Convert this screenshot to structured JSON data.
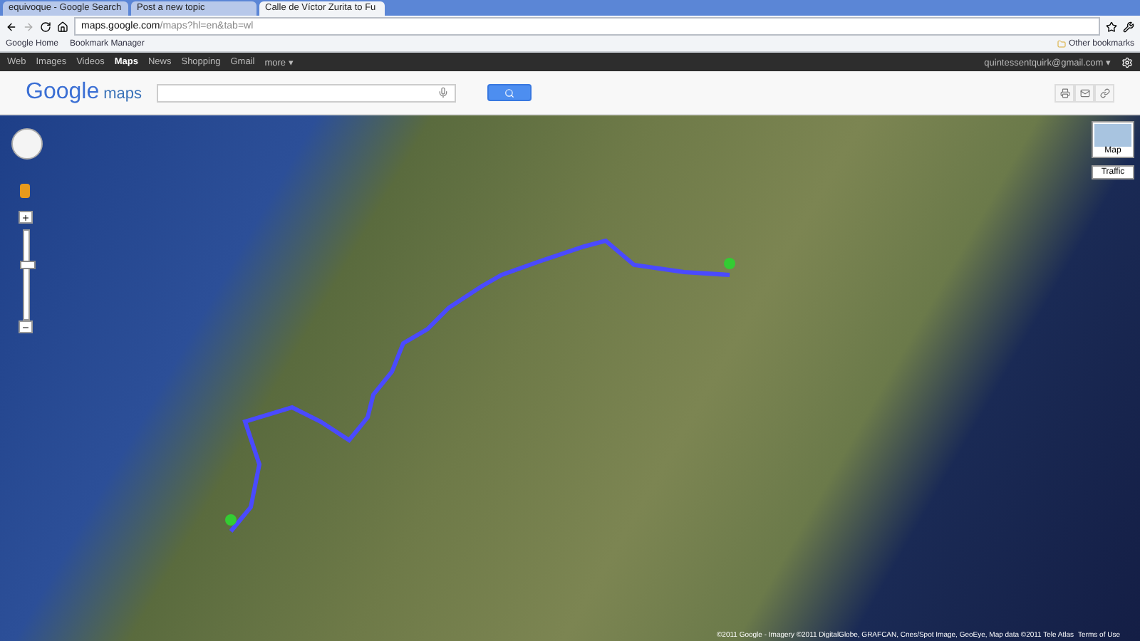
{
  "browser": {
    "tabs": [
      {
        "label": "equivoque - Google Search",
        "selected": false
      },
      {
        "label": "Post a new topic",
        "selected": false
      },
      {
        "label": "Calle de Víctor Zurita to Fu",
        "selected": true
      }
    ],
    "address": {
      "host": "maps.google.com",
      "path": "/maps?hl=en&tab=wl"
    },
    "bookmarks": [
      {
        "label": "Google Home"
      },
      {
        "label": "Bookmark Manager"
      }
    ],
    "other_bookmarks": "Other bookmarks"
  },
  "nav": {
    "items": [
      {
        "label": "Web",
        "selected": false
      },
      {
        "label": "Images",
        "selected": false
      },
      {
        "label": "Videos",
        "selected": false
      },
      {
        "label": "Maps",
        "selected": true
      },
      {
        "label": "News",
        "selected": false
      },
      {
        "label": "Shopping",
        "selected": false
      },
      {
        "label": "Gmail",
        "selected": false
      },
      {
        "label": "more ▾",
        "selected": false
      }
    ],
    "account": "quintessentquirk@gmail.com ▾"
  },
  "header": {
    "logo_word": "Google",
    "logo_suffix": "maps"
  },
  "map": {
    "zoom": {
      "level": 0.63
    },
    "layers": [
      {
        "label": "Map"
      },
      {
        "label": "Traffic"
      }
    ],
    "copyright": "©2011 Google - Imagery ©2011 DigitalGlobe, GRAFCAN, Cnes/Spot Image, GeoEye, Map data ©2011 Tele Atlas",
    "terms": "Terms of Use"
  }
}
